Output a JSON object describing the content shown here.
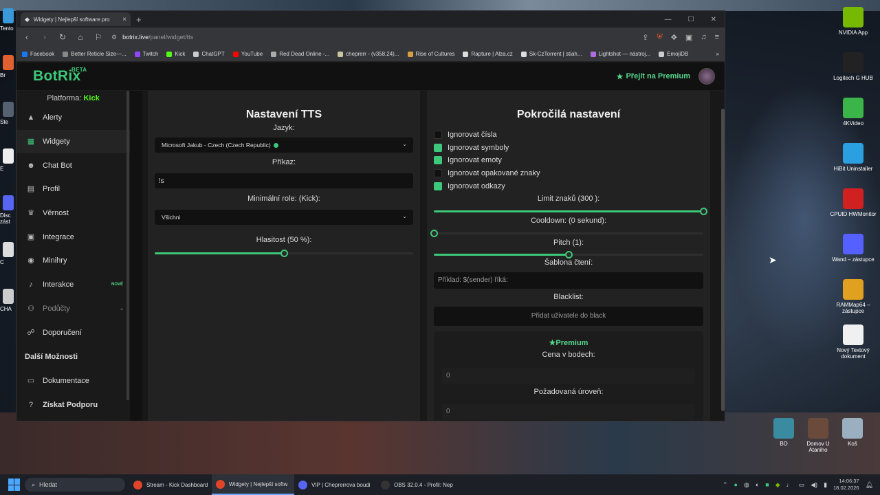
{
  "browser": {
    "tab_title": "Widgety | Nejlepší software pro",
    "url_host": "botrix.live",
    "url_path": "/panel/widget/tts"
  },
  "bookmarks": [
    {
      "label": "Facebook",
      "color": "#1877f2"
    },
    {
      "label": "Better Reticle Size—...",
      "color": "#888888"
    },
    {
      "label": "Twitch",
      "color": "#9146ff"
    },
    {
      "label": "Kick",
      "color": "#53fc18"
    },
    {
      "label": "ChatGPT",
      "color": "#cccccc"
    },
    {
      "label": "YouTube",
      "color": "#ff0000"
    },
    {
      "label": "Red Dead Online -...",
      "color": "#aaaaaa"
    },
    {
      "label": "cheprerr - (v358.24)...",
      "color": "#c8c8a0"
    },
    {
      "label": "Rise of Cultures",
      "color": "#d4a040"
    },
    {
      "label": "Rapture | Alza.cz",
      "color": "#dddddd"
    },
    {
      "label": "Sk-CzTorrent | stiah...",
      "color": "#dddddd"
    },
    {
      "label": "Lightshot — nástroj...",
      "color": "#b06be0"
    },
    {
      "label": "EmojiDB",
      "color": "#cccccc"
    }
  ],
  "app": {
    "logo": "BotRix",
    "beta": "BETA",
    "premium_link": "Přejít na Premium"
  },
  "sidebar": {
    "platform_label": "Platforma:",
    "platform_value": "Kick",
    "items": [
      {
        "label": "Alerty",
        "icon": "▲"
      },
      {
        "label": "Widgety",
        "icon": "▦"
      },
      {
        "label": "Chat Bot",
        "icon": "☻"
      },
      {
        "label": "Profil",
        "icon": "▤"
      },
      {
        "label": "Věrnost",
        "icon": "♛"
      },
      {
        "label": "Integrace",
        "icon": "▣"
      },
      {
        "label": "Minihry",
        "icon": "◉"
      },
      {
        "label": "Interakce",
        "icon": "♪"
      },
      {
        "label": "Podůčty",
        "icon": "⚇"
      },
      {
        "label": "Doporučení",
        "icon": "☍"
      }
    ],
    "new_badge": "NOVÉ",
    "section_title": "Další Možnosti",
    "extra_items": [
      {
        "label": "Dokumentace",
        "icon": "▭"
      },
      {
        "label": "Získat Podporu",
        "icon": "?"
      }
    ]
  },
  "tts_settings": {
    "title": "Nastavení TTS",
    "language_label": "Jazyk:",
    "language_value": "Microsoft Jakub - Czech (Czech Republic)",
    "command_label": "Příkaz:",
    "command_value": "!s",
    "role_label": "Minimální role: (Kick):",
    "role_value": "Všichni",
    "volume_label": "Hlasitost (50 %):",
    "volume_value": 50
  },
  "advanced": {
    "title": "Pokročilá nastavení",
    "checkboxes": [
      {
        "label": "Ignorovat čísla",
        "checked": false
      },
      {
        "label": "Ignorovat symboly",
        "checked": true
      },
      {
        "label": "Ignorovat emoty",
        "checked": true
      },
      {
        "label": "Ignorovat opakované znaky",
        "checked": false
      },
      {
        "label": "Ignorovat odkazy",
        "checked": true
      }
    ],
    "char_limit_label": "Limit znaků (300 ):",
    "char_limit_fraction": 1.0,
    "cooldown_label": "Cooldown: (0 sekund):",
    "cooldown_fraction": 0.0,
    "pitch_label": "Pitch (1):",
    "pitch_fraction": 0.5,
    "template_label": "Šablona čtení:",
    "template_placeholder": "Příklad: $(sender) říká:",
    "blacklist_label": "Blacklist:",
    "blacklist_placeholder": "Přidat uživatele do black",
    "premium_title": "Premium",
    "points_price_label": "Cena v bodech:",
    "points_price_value": "0",
    "required_level_label": "Požadovaná úroveň:",
    "required_level_value": "0"
  },
  "desktop": {
    "right_icons": [
      {
        "label": "NVIDIA App",
        "color": "#76b900"
      },
      {
        "label": "Logitech G HUB",
        "color": "#222222"
      },
      {
        "label": "4KVideo",
        "color": "#3bb54a"
      },
      {
        "label": "HiBit Uninstaller",
        "color": "#2aa0e0"
      },
      {
        "label": "CPUID HWMonitor",
        "color": "#d02020"
      },
      {
        "label": "Wand – zástupce",
        "color": "#5560ff"
      },
      {
        "label": "RAMMap64 – zástupce",
        "color": "#e0a020"
      },
      {
        "label": "Nový Textový dokument",
        "color": "#f0f0f0"
      }
    ],
    "bottom_icons": [
      {
        "label": "BO",
        "color": "#3a8aa0"
      },
      {
        "label": "Domov U Ataniho",
        "color": "#6a4a3a"
      },
      {
        "label": "Koš",
        "color": "#9ab0c0"
      }
    ],
    "left_labels": [
      "Tento",
      "Br",
      "Ste",
      "E",
      "Disc zást",
      "C",
      "CHA"
    ]
  },
  "taskbar": {
    "search_placeholder": "Hledat",
    "items": [
      {
        "label": "Stream - Kick Dashboard",
        "color": "#e0452c"
      },
      {
        "label": "Widgety | Nejlepší softw",
        "color": "#e0452c"
      },
      {
        "label": "VIP | Cheprerrova boudi",
        "color": "#5865f2"
      },
      {
        "label": "OBS 32.0.4 - Profil: Nep",
        "color": "#333333"
      }
    ],
    "time": "14:06:37",
    "date": "18.02.2026"
  }
}
